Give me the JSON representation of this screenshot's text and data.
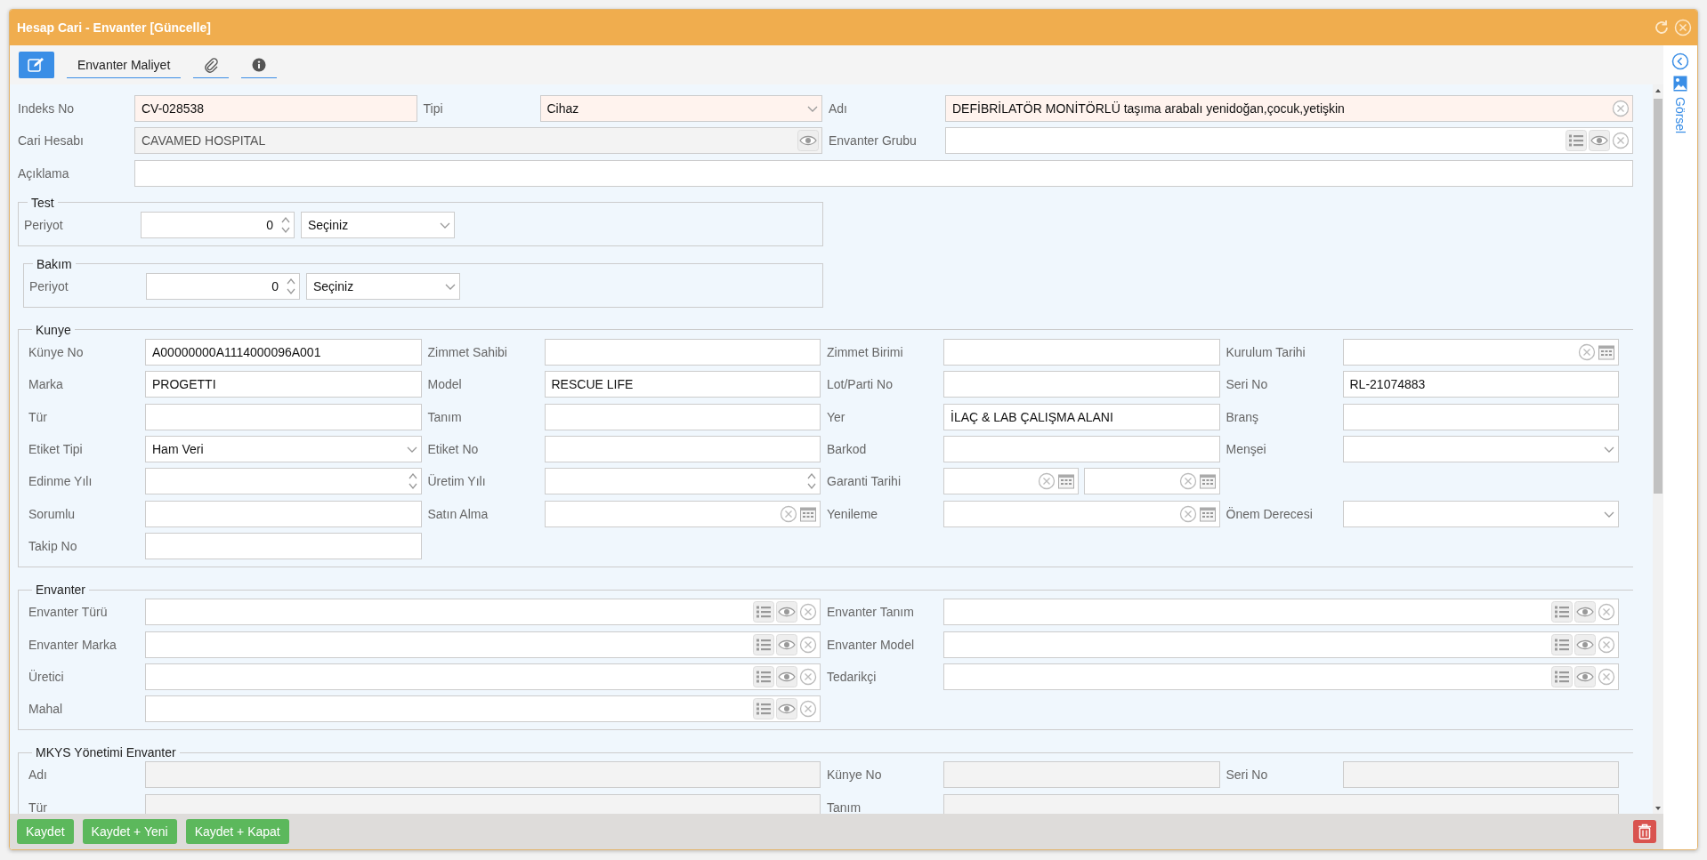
{
  "window": {
    "title": "Hesap Cari - Envanter [Güncelle]"
  },
  "toolbar": [
    {
      "kind": "edit",
      "selected": true
    },
    {
      "kind": "text",
      "label": "Envanter Maliyet",
      "selected": false
    },
    {
      "kind": "attach",
      "selected": false
    },
    {
      "kind": "info",
      "selected": false
    }
  ],
  "header": {
    "fields": [
      {
        "label": "Indeks No",
        "kind": "text",
        "value": "CV-028538",
        "required": true,
        "disabled": false
      },
      {
        "label": "Tipi",
        "kind": "select",
        "value": "Cihaz",
        "required": true,
        "disabled": false
      },
      {
        "label": "Adı",
        "kind": "clearable",
        "value": "DEFİBRİLATÖR MONİTÖRLÜ taşıma arabalı yenidoğan,çocuk,yetişkin",
        "required": true,
        "disabled": false
      },
      {
        "label": "Cari Hesabı",
        "kind": "view",
        "value": "CAVAMED HOSPITAL",
        "required": false,
        "disabled": true
      },
      {
        "label": "Envanter Grubu",
        "kind": "lookup",
        "required": false,
        "disabled": false
      },
      {
        "label": "Açıklama",
        "kind": "text",
        "required": false,
        "disabled": false
      }
    ]
  },
  "periods": [
    {
      "legend": "Test",
      "label": "Periyot",
      "value": "0",
      "unit": "Seçiniz"
    },
    {
      "legend": "Bakım",
      "label": "Periyot",
      "value": "0",
      "unit": "Seçiniz"
    }
  ],
  "kunye": {
    "legend": "Kunye",
    "rows": [
      [
        {
          "label": "Künye No",
          "kind": "text",
          "value": "A00000000A1114000096A001"
        },
        {
          "label": "Zimmet Sahibi",
          "kind": "text"
        },
        {
          "label": "Zimmet Birimi",
          "kind": "text"
        },
        {
          "label": "Kurulum Tarihi",
          "kind": "date"
        }
      ],
      [
        {
          "label": "Marka",
          "kind": "text",
          "value": "PROGETTI"
        },
        {
          "label": "Model",
          "kind": "text",
          "value": "RESCUE LIFE"
        },
        {
          "label": "Lot/Parti No",
          "kind": "text"
        },
        {
          "label": "Seri No",
          "kind": "text",
          "value": "RL-21074883"
        }
      ],
      [
        {
          "label": "Tür",
          "kind": "text"
        },
        {
          "label": "Tanım",
          "kind": "text"
        },
        {
          "label": "Yer",
          "kind": "text",
          "value": "İLAÇ & LAB ÇALIŞMA ALANI"
        },
        {
          "label": "Branş",
          "kind": "text"
        }
      ],
      [
        {
          "label": "Etiket Tipi",
          "kind": "select",
          "value": "Ham Veri"
        },
        {
          "label": "Etiket No",
          "kind": "text"
        },
        {
          "label": "Barkod",
          "kind": "text"
        },
        {
          "label": "Menşei",
          "kind": "select"
        }
      ],
      [
        {
          "label": "Edinme Yılı",
          "kind": "spin"
        },
        {
          "label": "Üretim Yılı",
          "kind": "spin"
        },
        {
          "label": "Garanti Tarihi",
          "kind": "date-pair"
        }
      ],
      [
        {
          "label": "Sorumlu",
          "kind": "text"
        },
        {
          "label": "Satın Alma",
          "kind": "date"
        },
        {
          "label": "Yenileme",
          "kind": "date"
        },
        {
          "label": "Önem Derecesi",
          "kind": "select"
        }
      ],
      [
        {
          "label": "Takip No",
          "kind": "text"
        }
      ]
    ]
  },
  "envanter": {
    "legend": "Envanter",
    "rows": [
      [
        {
          "label": "Envanter Türü",
          "kind": "lookup"
        },
        {
          "label": "Envanter Tanım",
          "kind": "lookup"
        }
      ],
      [
        {
          "label": "Envanter Marka",
          "kind": "lookup"
        },
        {
          "label": "Envanter Model",
          "kind": "lookup"
        }
      ],
      [
        {
          "label": "Üretici",
          "kind": "lookup"
        },
        {
          "label": "Tedarikçi",
          "kind": "lookup"
        }
      ],
      [
        {
          "label": "Mahal",
          "kind": "lookup"
        }
      ]
    ]
  },
  "mkys": {
    "legend": "MKYS Yönetimi Envanter",
    "rows": [
      [
        {
          "label": "Adı",
          "kind": "text",
          "disabled": true
        },
        {
          "label": "Künye No",
          "kind": "text",
          "disabled": true
        },
        {
          "label": "Seri No",
          "kind": "text",
          "disabled": true
        }
      ],
      [
        {
          "label": "Tür",
          "kind": "text",
          "disabled": true
        },
        {
          "label": "Tanım",
          "kind": "text",
          "disabled": true
        }
      ]
    ]
  },
  "footer": {
    "buttons": [
      "Kaydet",
      "Kaydet + Yeni",
      "Kaydet + Kapat"
    ]
  },
  "side": {
    "label": "Görsel"
  }
}
